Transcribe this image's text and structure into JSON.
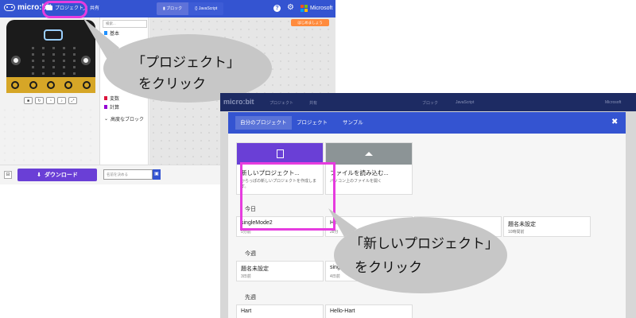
{
  "editor": {
    "logo": "micro:bit",
    "projects_label": "プロジェクト",
    "share_label": "共有",
    "blocks_label": "ブロック",
    "javascript_label": "JavaScript",
    "microsoft": "Microsoft",
    "orange_button": "はじめましょう",
    "search_placeholder": "検索...",
    "toolbox": [
      {
        "label": "基本",
        "color": "#1e90ff"
      },
      {
        "label": "変数",
        "color": "#dc143c"
      },
      {
        "label": "計算",
        "color": "#9400d3"
      },
      {
        "label": "高度なブロック",
        "color": "#333333"
      }
    ],
    "download_label": "ダウンロード",
    "name_placeholder": "名前を決める"
  },
  "callout1": {
    "line1": "「プロジェクト」",
    "line2": "をクリック"
  },
  "callout2": {
    "line1": "「新しいプロジェクト」",
    "line2": "をクリック"
  },
  "dialog_bg": {
    "logo": "micro:bit",
    "projects_label": "プロジェクト",
    "share_label": "共有",
    "blocks_label": "ブロック",
    "javascript_label": "JavaScript",
    "microsoft": "Microsoft"
  },
  "dialog": {
    "tabs": [
      "自分のプロジェクト",
      "プロジェクト",
      "サンプル"
    ],
    "close": "✖",
    "new_project": {
      "title": "新しいプロジェクト...",
      "desc": "からっぽの新しいプロジェクトを作成します。",
      "color": "#6a3fd6"
    },
    "import_file": {
      "title": "ファイルを読み込む...",
      "desc": "パソコン上のファイルを開く",
      "color": "#8c9496"
    },
    "sections": [
      {
        "label": "今日",
        "items": [
          {
            "name": "singleMode2",
            "age": "5分前"
          },
          {
            "name": "He",
            "age": "28分"
          },
          {
            "name": "",
            "age": ""
          },
          {
            "name": "題名未設定",
            "age": "10時間前"
          }
        ]
      },
      {
        "label": "今週",
        "items": [
          {
            "name": "題名未設定",
            "age": "3日前"
          },
          {
            "name": "single",
            "age": "4日前"
          }
        ]
      },
      {
        "label": "先週",
        "items": [
          {
            "name": "Hart",
            "age": ""
          },
          {
            "name": "Hello-Hart",
            "age": ""
          }
        ]
      }
    ]
  }
}
